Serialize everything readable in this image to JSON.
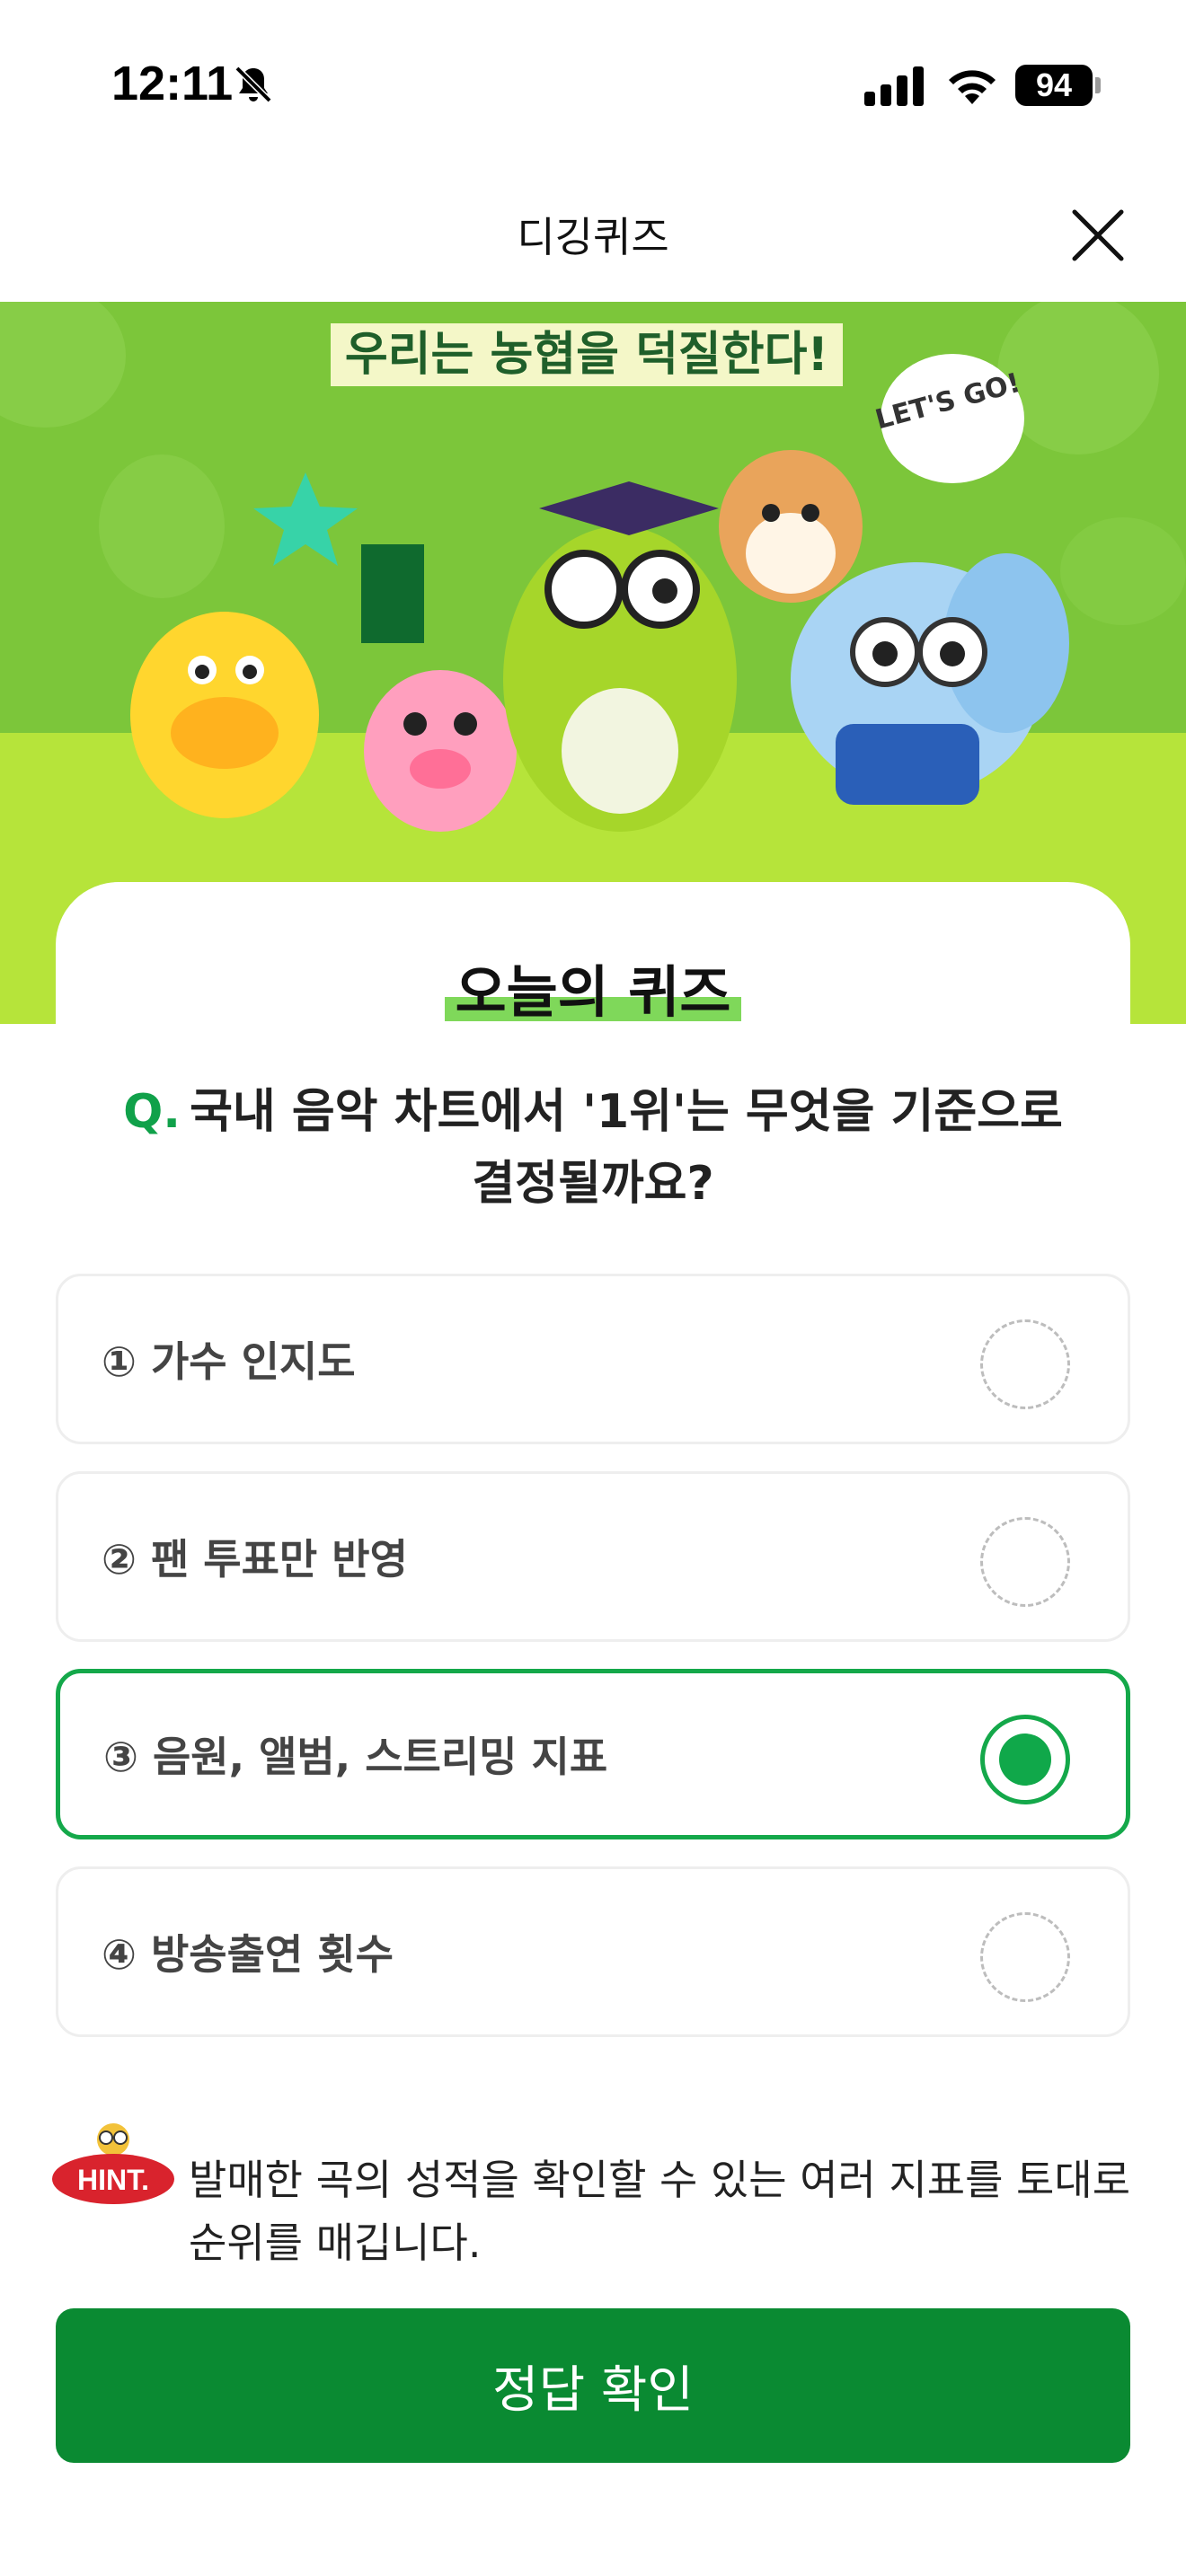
{
  "status_bar": {
    "time": "12:11",
    "battery": "94"
  },
  "header": {
    "title": "디깅퀴즈"
  },
  "banner": {
    "headline": "우리는 농협을 덕질한다!",
    "bubble": "LET'S GO!"
  },
  "quiz": {
    "heading": "오늘의 퀴즈",
    "question_prefix": "Q.",
    "question": "국내 음악 차트에서 '1위'는 무엇을 기준으로 결정될까요?",
    "options": [
      {
        "label": "① 가수 인지도",
        "selected": false
      },
      {
        "label": "② 팬 투표만 반영",
        "selected": false
      },
      {
        "label": "③ 음원, 앨범, 스트리밍 지표",
        "selected": true
      },
      {
        "label": "④ 방송출연 횟수",
        "selected": false
      }
    ],
    "hint_badge": "HINT.",
    "hint": "발매한 곡의 성적을 확인할 수 있는 여러 지표를 토대로 순위를 매깁니다.",
    "confirm_label": "정답 확인"
  },
  "colors": {
    "accent": "#10a84a",
    "button": "#0a8a32",
    "banner": "#7cc63a"
  }
}
